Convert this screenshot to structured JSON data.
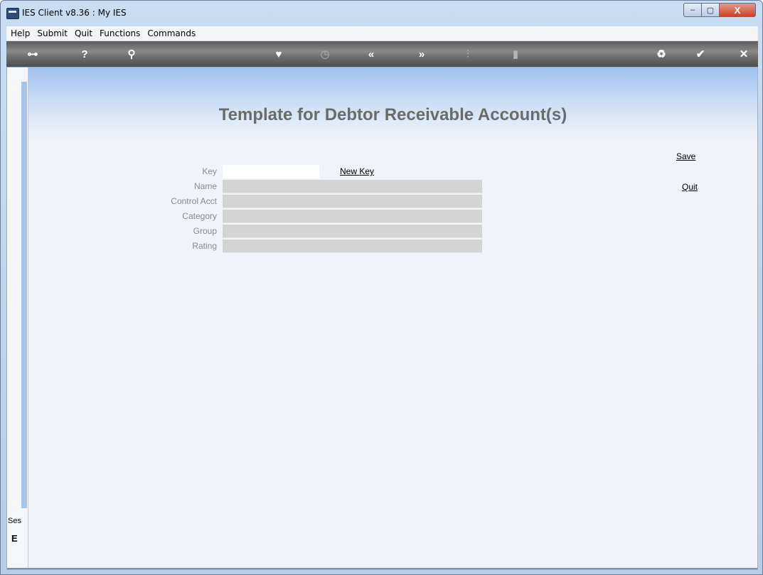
{
  "window": {
    "title": "IES Client v8.36 : My IES",
    "controls": {
      "minimize": "–",
      "maximize": "▢",
      "close": "X"
    }
  },
  "menu": [
    "Help",
    "Submit",
    "Quit",
    "Functions",
    "Commands"
  ],
  "toolbar": {
    "icons": [
      {
        "name": "key-icon",
        "glyph": "⊶"
      },
      {
        "name": "help-icon",
        "glyph": "?"
      },
      {
        "name": "search-icon",
        "glyph": "⚲"
      },
      {
        "name": "heart-icon",
        "glyph": "♥"
      },
      {
        "name": "clock-icon",
        "glyph": "◷"
      },
      {
        "name": "back-icon",
        "glyph": "«"
      },
      {
        "name": "forward-icon",
        "glyph": "»"
      },
      {
        "name": "tools-icon",
        "glyph": "⫶"
      },
      {
        "name": "film-icon",
        "glyph": "▮"
      },
      {
        "name": "recycle-icon",
        "glyph": "♻"
      },
      {
        "name": "check-icon",
        "glyph": "✔"
      },
      {
        "name": "close-icon",
        "glyph": "✕"
      }
    ]
  },
  "page": {
    "title": "Template for Debtor Receivable Account(s)"
  },
  "form": {
    "key_label": "Key",
    "key_value": "",
    "new_key_link": "New Key",
    "fields": [
      {
        "label": "Name",
        "value": ""
      },
      {
        "label": "Control Acct",
        "value": ""
      },
      {
        "label": "Category",
        "value": ""
      },
      {
        "label": "Group",
        "value": ""
      },
      {
        "label": "Rating",
        "value": ""
      }
    ]
  },
  "actions": {
    "save": "Save",
    "quit": "Quit"
  },
  "session": {
    "label": "Ses",
    "glyph": "E"
  }
}
